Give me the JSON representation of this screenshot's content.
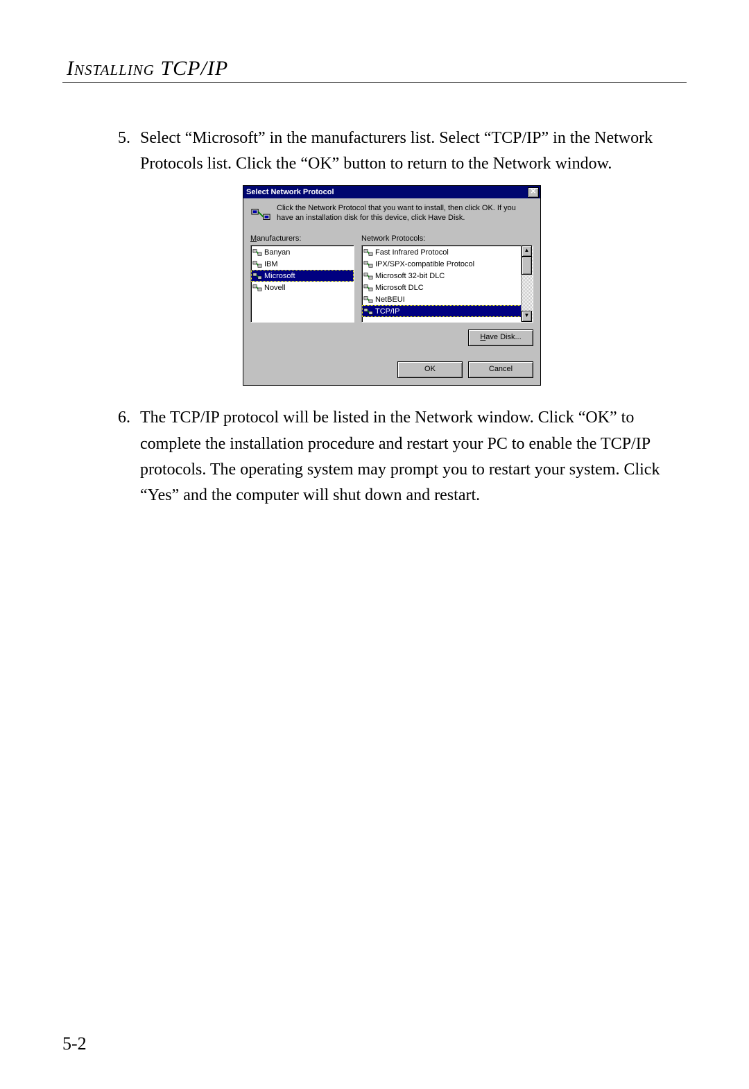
{
  "page": {
    "heading": "Installing TCP/IP",
    "page_number": "5-2"
  },
  "steps": {
    "s5": {
      "num": "5.",
      "text": "Select “Microsoft” in the manufacturers list. Select “TCP/IP” in the Network Protocols list. Click the “OK” button to return to the Network window."
    },
    "s6": {
      "num": "6.",
      "text": "The TCP/IP protocol will be listed in the Network window. Click “OK” to complete the installation procedure and restart your PC to enable the TCP/IP protocols. The operating system may prompt you to restart your system. Click “Yes” and the computer will shut down and restart."
    }
  },
  "dialog": {
    "title": "Select Network Protocol",
    "close_glyph": "✕",
    "intro": "Click the Network Protocol that you want to install, then click OK. If you have an installation disk for this device, click Have Disk.",
    "manufacturers_label_pre": "M",
    "manufacturers_label_rest": "anufacturers:",
    "protocols_label": "Network Protocols:",
    "manufacturers": [
      {
        "name": "Banyan",
        "selected": false
      },
      {
        "name": "IBM",
        "selected": false
      },
      {
        "name": "Microsoft",
        "selected": true
      },
      {
        "name": "Novell",
        "selected": false
      }
    ],
    "protocols": [
      {
        "name": "Fast Infrared Protocol",
        "selected": false
      },
      {
        "name": "IPX/SPX-compatible Protocol",
        "selected": false
      },
      {
        "name": "Microsoft 32-bit DLC",
        "selected": false
      },
      {
        "name": "Microsoft DLC",
        "selected": false
      },
      {
        "name": "NetBEUI",
        "selected": false
      },
      {
        "name": "TCP/IP",
        "selected": true
      }
    ],
    "buttons": {
      "have_disk_pre": "H",
      "have_disk_rest": "ave Disk...",
      "ok": "OK",
      "cancel": "Cancel"
    },
    "scroll": {
      "up": "▲",
      "down": "▼"
    }
  }
}
